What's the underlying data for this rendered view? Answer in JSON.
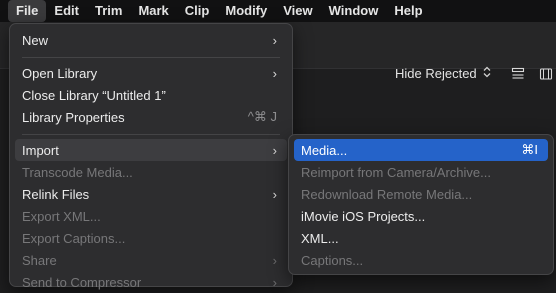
{
  "menubar": {
    "items": [
      {
        "label": "File",
        "active": true
      },
      {
        "label": "Edit"
      },
      {
        "label": "Trim"
      },
      {
        "label": "Mark"
      },
      {
        "label": "Clip"
      },
      {
        "label": "Modify"
      },
      {
        "label": "View"
      },
      {
        "label": "Window"
      },
      {
        "label": "Help"
      }
    ]
  },
  "toolbar": {
    "filter_label": "Hide Rejected",
    "filter_icon": "chevron-updown-icon",
    "list_view_icon": "list-view-icon",
    "filmstrip_icon": "filmstrip-icon"
  },
  "file_menu": {
    "new": {
      "label": "New",
      "arrow": "›"
    },
    "open_library": {
      "label": "Open Library",
      "arrow": "›"
    },
    "close_library": {
      "label": "Close Library “Untitled 1”"
    },
    "library_properties": {
      "label": "Library Properties",
      "shortcut": "^⌘ J"
    },
    "import": {
      "label": "Import",
      "arrow": "›"
    },
    "transcode_media": {
      "label": "Transcode Media..."
    },
    "relink_files": {
      "label": "Relink Files",
      "arrow": "›"
    },
    "export_xml": {
      "label": "Export XML..."
    },
    "export_captions": {
      "label": "Export Captions..."
    },
    "share": {
      "label": "Share",
      "arrow": "›"
    },
    "send_to_compressor": {
      "label": "Send to Compressor",
      "arrow": "›"
    }
  },
  "import_menu": {
    "media": {
      "label": "Media...",
      "shortcut": "⌘I"
    },
    "reimport": {
      "label": "Reimport from Camera/Archive..."
    },
    "redownload": {
      "label": "Redownload Remote Media..."
    },
    "imovie": {
      "label": "iMovie iOS Projects..."
    },
    "xml": {
      "label": "XML..."
    },
    "captions": {
      "label": "Captions..."
    }
  },
  "colors": {
    "selection": "#2563c9",
    "menu_bg": "#2d2d2f",
    "disabled_text": "#777779"
  }
}
